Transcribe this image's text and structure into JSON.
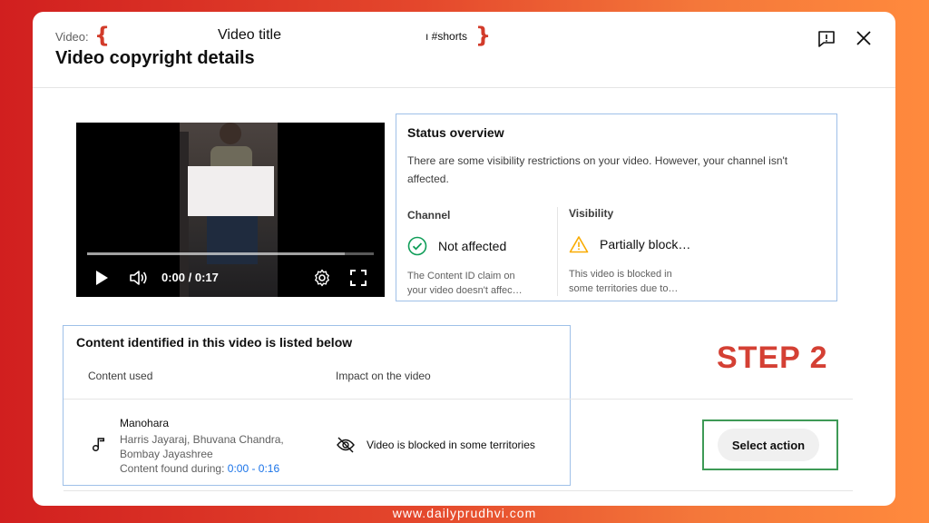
{
  "header": {
    "video_label": "Video:",
    "brace_open": "{",
    "video_title": "Video title",
    "video_tag": "ı #shorts",
    "brace_close": "}",
    "dialog_title": "Video copyright details",
    "icons": {
      "feedback": "feedback-icon",
      "close": "close-icon"
    }
  },
  "player": {
    "time": "0:00 / 0:17",
    "progress": 0.0,
    "icons": [
      "play-icon",
      "volume-icon",
      "settings-gear-icon",
      "fullscreen-icon"
    ]
  },
  "status": {
    "title": "Status overview",
    "description": "There are some visibility restrictions on your video. However, your channel isn't affected.",
    "channel": {
      "heading": "Channel",
      "value": "Not affected",
      "note": "The Content ID claim on your video doesn't affec…",
      "icon": "check-circle-icon",
      "color": "#0f9d58"
    },
    "visibility": {
      "heading": "Visibility",
      "value": "Partially block…",
      "note": "This video is blocked in some territories due to…",
      "icon": "warning-icon",
      "color": "#f9ab00"
    }
  },
  "content": {
    "title": "Content identified in this video is listed below",
    "col_content": "Content used",
    "col_impact": "Impact on the video",
    "row": {
      "song": "Manohara",
      "artists": "Harris Jayaraj, Bhuvana Chandra, Bombay Jayashree",
      "found_label": "Content found during:",
      "found_range": "0:00 - 0:16",
      "impact": "Video is blocked in some territories",
      "action": "Select action"
    }
  },
  "annotation": {
    "step": "STEP 2",
    "color": "#d44034"
  },
  "watermark": "www.dailyprudhvi.com"
}
